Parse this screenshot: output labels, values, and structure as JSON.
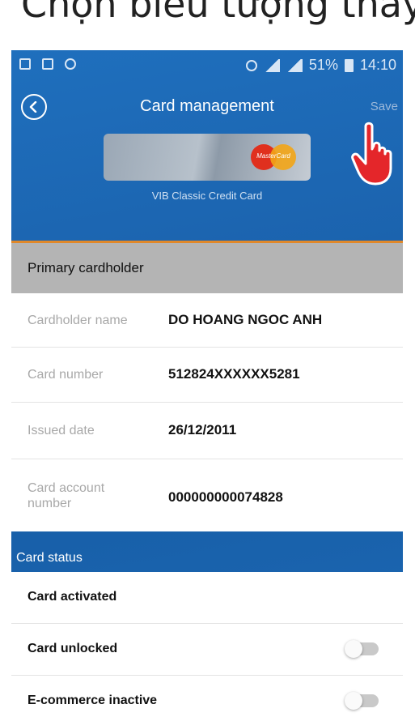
{
  "caption": "Chọn biểu tượng thay đổi",
  "status_bar": {
    "icons_left": [
      "screenshot-icon",
      "mail-icon",
      "sync-icon"
    ],
    "battery_percent": "51%",
    "time": "14:10"
  },
  "app_bar": {
    "title": "Card management",
    "save_label": "Save"
  },
  "card": {
    "name": "VIB Classic Credit Card",
    "brand": "MasterCard"
  },
  "primary_section": {
    "header": "Primary cardholder",
    "rows": [
      {
        "label": "Cardholder name",
        "value": "DO HOANG NGOC ANH"
      },
      {
        "label": "Card number",
        "value": "512824XXXXXX5281"
      },
      {
        "label": "Issued date",
        "value": "26/12/2011"
      },
      {
        "label": "Card account number",
        "value": "000000000074828"
      }
    ]
  },
  "card_status": {
    "header": "Card status",
    "items": [
      {
        "label": "Card activated"
      },
      {
        "label": "Card unlocked",
        "toggle": "off"
      },
      {
        "label": "E-commerce inactive",
        "toggle": "off"
      }
    ]
  },
  "colors": {
    "app_blue": "#1b63ae",
    "accent_orange": "#e0882a",
    "hand_red": "#e4262a"
  }
}
